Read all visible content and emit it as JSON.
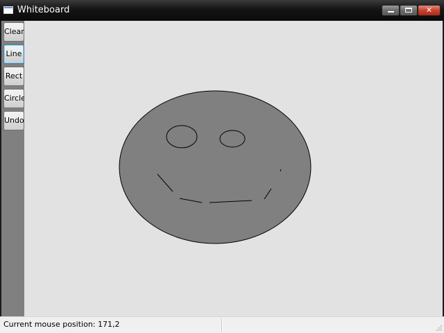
{
  "window": {
    "title": "Whiteboard",
    "controls": {
      "minimize": "minimize",
      "maximize": "maximize",
      "close": "close"
    }
  },
  "toolbar": {
    "buttons": [
      {
        "label": "Clear",
        "active": false
      },
      {
        "label": "Line",
        "active": true
      },
      {
        "label": "Rect",
        "active": false
      },
      {
        "label": "Circle",
        "active": false
      },
      {
        "label": "Undo",
        "active": false
      }
    ]
  },
  "drawing": {
    "fill_color": "#808080",
    "stroke_color": "#000000",
    "background_color": "#e2e2e2"
  },
  "statusbar": {
    "text": "Current mouse position: 171,2"
  }
}
